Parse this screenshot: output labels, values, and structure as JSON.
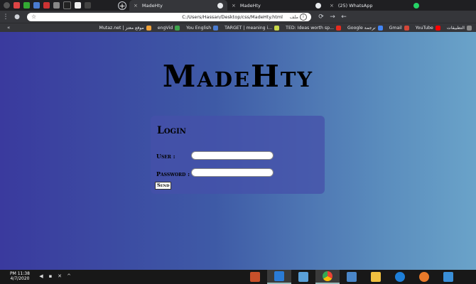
{
  "browser": {
    "tabs": [
      {
        "label": "MadeHty",
        "active": true
      },
      {
        "label": "MadeHty",
        "active": false
      },
      {
        "label": "(25) WhatsApp",
        "active": false
      }
    ],
    "new_tab_glyph": "+",
    "close_glyph": "×",
    "address": {
      "url": "C:/Users/Hassan/Desktop/css/MadeHty.html",
      "scheme_label": "ملف",
      "info_glyph": "i"
    },
    "nav": {
      "back": "←",
      "forward": "→",
      "reload": "⟳",
      "menu": "⋮"
    },
    "bookmarks_more": "«",
    "bookmarks": [
      {
        "label": "Mutaz.net | موقع معتز",
        "color": "#f2a33a"
      },
      {
        "label": "engVid",
        "color": "#3fa34d"
      },
      {
        "label": "You English",
        "color": "#4a7bd0"
      },
      {
        "label": "TARGET | meaning i...",
        "color": "#c8d84a"
      },
      {
        "label": "TED: Ideas worth sp...",
        "color": "#e62b1e"
      },
      {
        "label": "Google ترجمة",
        "color": "#4285f4"
      },
      {
        "label": "Gmail",
        "color": "#d44638"
      },
      {
        "label": "YouTube",
        "color": "#ff0000"
      },
      {
        "label": "التطبيقات",
        "color": "#8a8a8a"
      }
    ]
  },
  "page": {
    "site_title": "MadeHty",
    "login": {
      "heading": "Login",
      "user_label": "User :",
      "user_value": "",
      "password_label": "Password :",
      "password_value": "",
      "send_label": "Send"
    }
  },
  "taskbar": {
    "time": "PM 11:38",
    "date": "4/7/2020",
    "apps": [
      {
        "name": "file-explorer",
        "color": "#e8a33a"
      },
      {
        "name": "visual-studio-code",
        "color": "#2a7bd6"
      },
      {
        "name": "notepad",
        "color": "#5aa0d8"
      },
      {
        "name": "chrome",
        "color": "#e8453c"
      },
      {
        "name": "windows-app",
        "color": "#4a86c8"
      },
      {
        "name": "file-manager",
        "color": "#f0c040"
      },
      {
        "name": "internet-explorer",
        "color": "#1e7fd8"
      },
      {
        "name": "firefox",
        "color": "#e87a2a"
      },
      {
        "name": "media",
        "color": "#3a8fd8"
      }
    ]
  }
}
